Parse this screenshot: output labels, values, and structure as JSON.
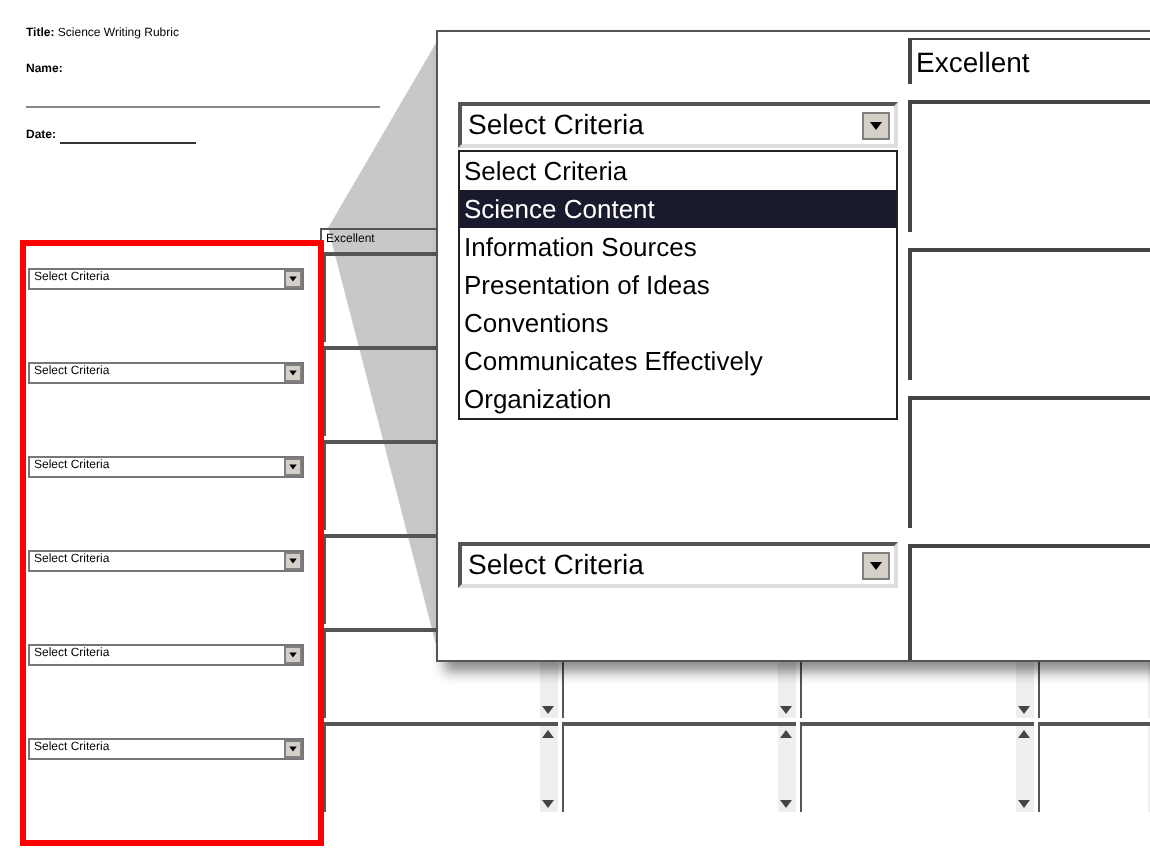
{
  "document": {
    "title": "**Title:** Science Writing Rubric",
    "name_label": "Name:",
    "date_label": "Date:"
  },
  "table": {
    "columns": [
      "Excellent"
    ],
    "rows": [
      {
        "criteria": "Select Criteria"
      },
      {
        "criteria": "Select Criteria"
      },
      {
        "criteria": "Select Criteria"
      },
      {
        "criteria": "Select Criteria"
      },
      {
        "criteria": "Select Criteria"
      },
      {
        "criteria": "Select Criteria"
      }
    ]
  },
  "magnifier": {
    "column": "Excellent",
    "dropdown": {
      "value": "Select Criteria",
      "expanded": true,
      "options": [
        {
          "label": "Select Criteria",
          "highlighted": false
        },
        {
          "label": "Science Content",
          "highlighted": true
        },
        {
          "label": "Information Sources",
          "highlighted": false
        },
        {
          "label": "Presentation of Ideas",
          "highlighted": false
        },
        {
          "label": "Conventions",
          "highlighted": false
        },
        {
          "label": "Communicates Effectively",
          "highlighted": false
        },
        {
          "label": "Organization",
          "highlighted": false
        }
      ]
    },
    "second_select": {
      "value": "Select Criteria"
    }
  }
}
